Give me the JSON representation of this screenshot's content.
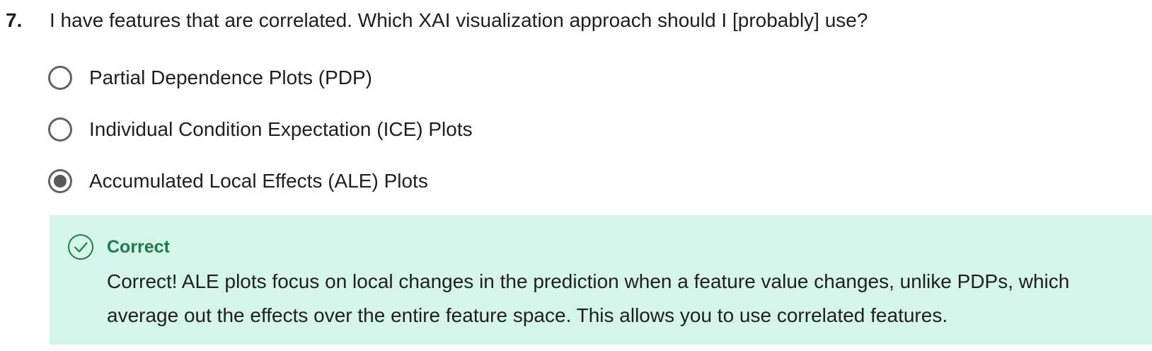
{
  "question": {
    "number": "7.",
    "text": "I have features that are correlated. Which XAI visualization approach should I [probably] use?",
    "options": [
      {
        "label": "Partial Dependence Plots (PDP)",
        "selected": false
      },
      {
        "label": "Individual Condition Expectation (ICE) Plots",
        "selected": false
      },
      {
        "label": "Accumulated Local Effects (ALE) Plots",
        "selected": true
      }
    ]
  },
  "feedback": {
    "icon": "check-circle-icon",
    "status": "Correct",
    "message": "Correct! ALE plots focus on local changes in the prediction when a feature value changes, unlike PDPs, which average out the effects over the entire feature space. This allows you to use correlated features.",
    "background_color": "#d5f5ea",
    "accent_color": "#1f7a4c"
  }
}
